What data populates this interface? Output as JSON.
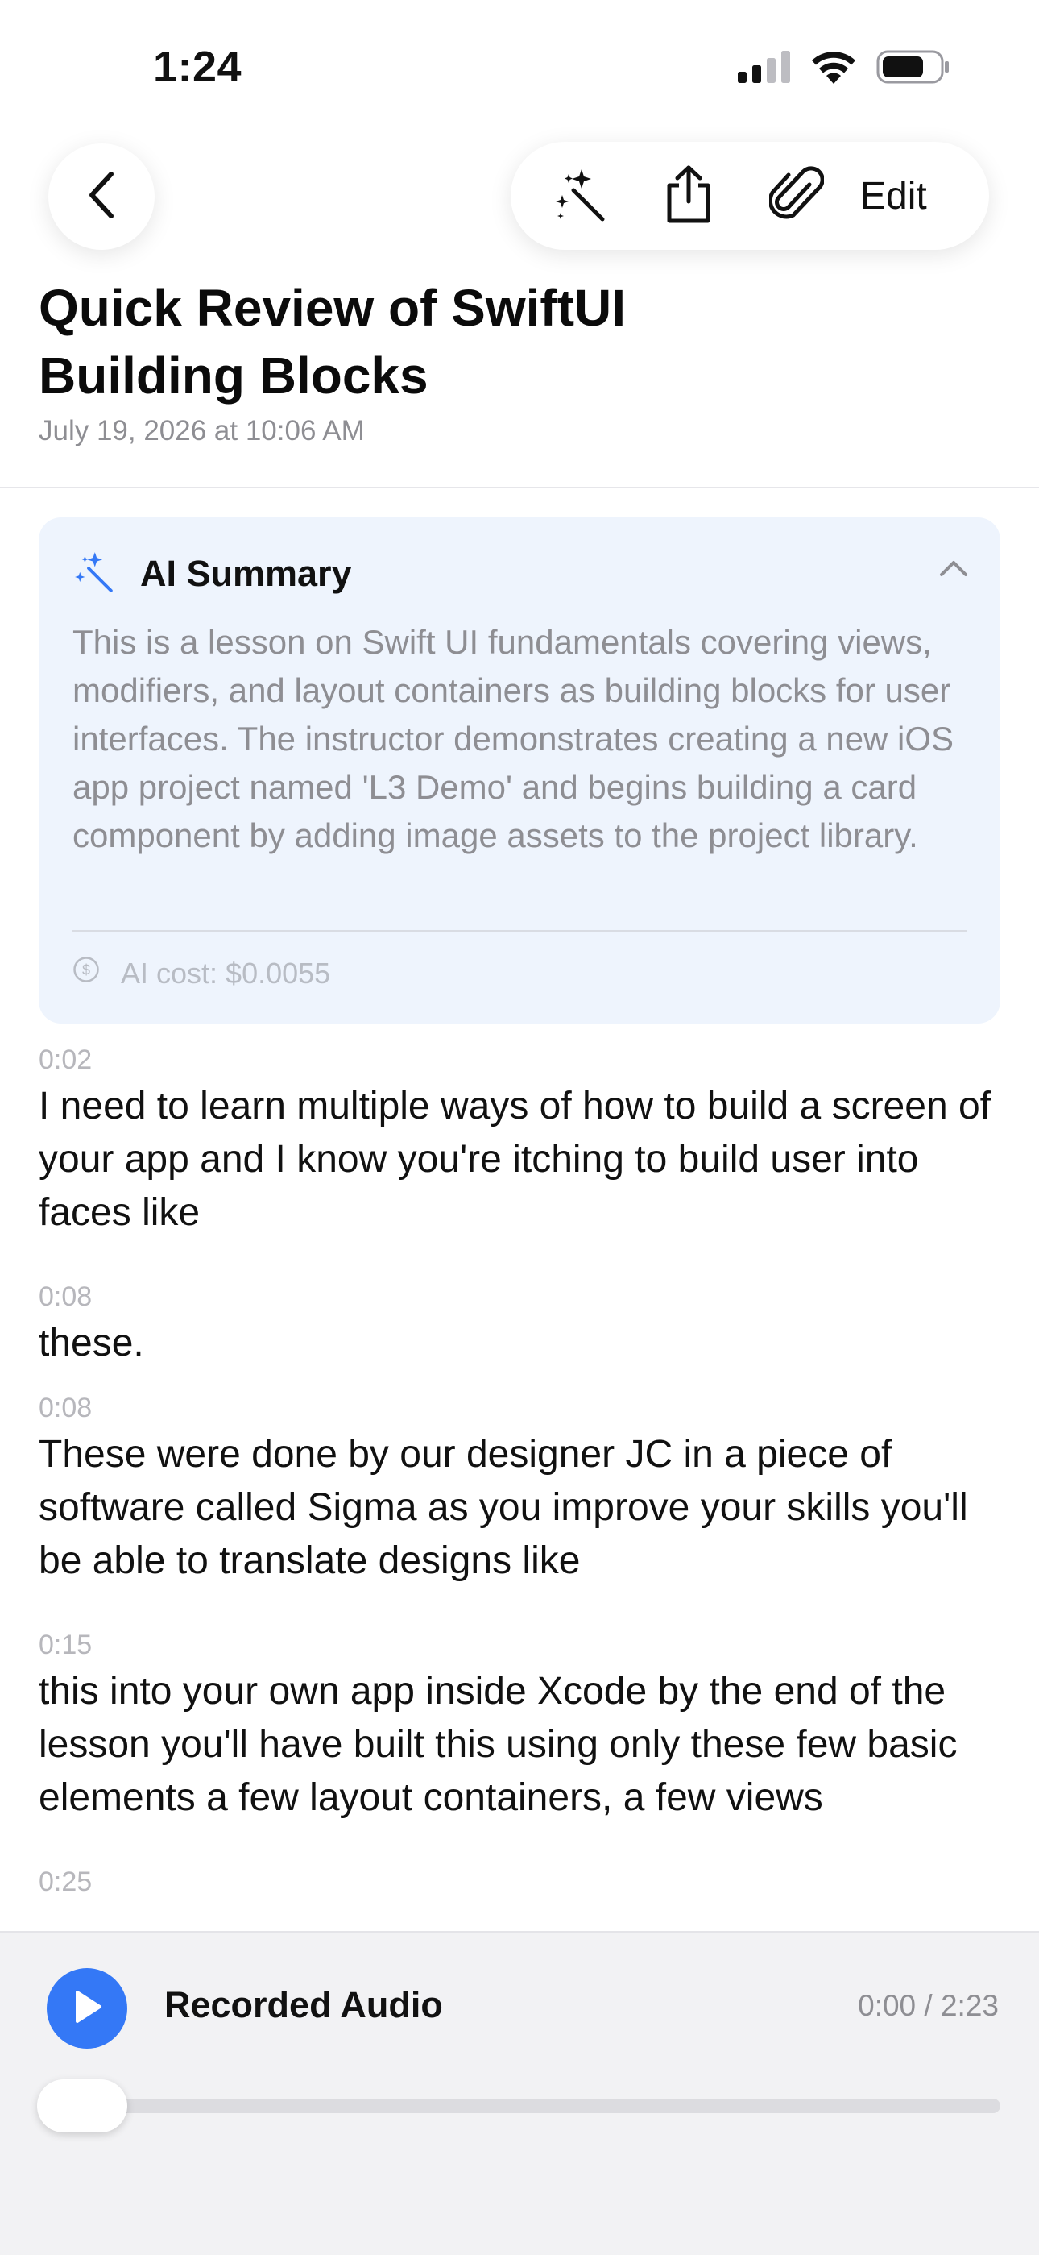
{
  "status_bar": {
    "time": "1:24",
    "icons": [
      "cellular-signal-icon",
      "wifi-icon",
      "battery-icon"
    ]
  },
  "nav": {
    "back_icon": "chevron-left-icon",
    "toolbar_icons": [
      "magic-wand-icon",
      "share-icon",
      "paperclip-icon"
    ],
    "edit_label": "Edit"
  },
  "note": {
    "title": "Quick Review of SwiftUI Building Blocks",
    "date": "July 19, 2026 at 10:06 AM"
  },
  "ai_summary": {
    "icon": "magic-wand-icon",
    "title": "AI Summary",
    "toggle_icon": "chevron-up-icon",
    "text": "This is a lesson on Swift UI fundamentals covering views, modifiers, and layout containers as building blocks for user interfaces. The instructor demonstrates creating a new iOS app project named 'L3 Demo' and begins building a card component by adding image assets to the project library.",
    "cost_icon": "dollar-circle-icon",
    "cost": "AI cost: $0.0055"
  },
  "transcript": [
    {
      "time": "0:02",
      "text": "I need to learn multiple ways of how to build a screen of your app and I know you're itching to build user into faces like"
    },
    {
      "time": "0:08",
      "text": "these."
    },
    {
      "time": "0:08",
      "text": "These were done by our designer JC in a piece of software called Sigma as you improve your skills you'll be able to translate designs like"
    },
    {
      "time": "0:15",
      "text": "this into your own app inside Xcode by the end of the lesson you'll have built this using only these few basic elements a few layout containers, a few views"
    },
    {
      "time": "0:25",
      "text": ""
    }
  ],
  "player": {
    "title": "Recorded Audio",
    "time": "0:00 / 2:23",
    "progress": 0.0
  },
  "colors": {
    "accent": "#3478f6",
    "summary_bg": "#eef4fd",
    "secondary_text": "#8e8e93"
  }
}
